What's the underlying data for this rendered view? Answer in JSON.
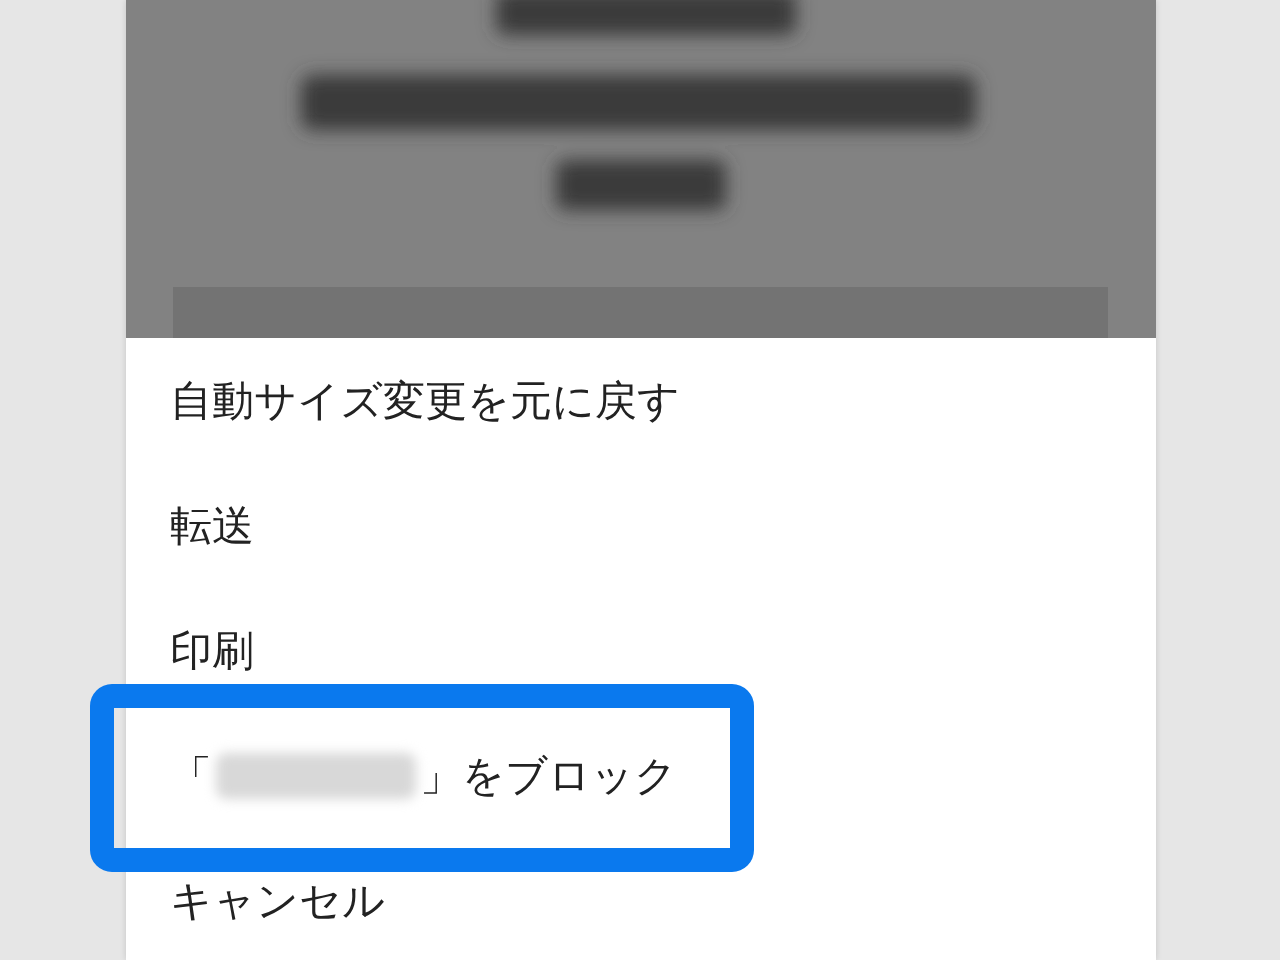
{
  "menu": [
    {
      "kind": "text",
      "label": "自動サイズ変更を元に戻す",
      "selected": false
    },
    {
      "kind": "text",
      "label": "転送",
      "selected": false
    },
    {
      "kind": "text",
      "label": "印刷",
      "selected": false
    },
    {
      "kind": "redacted",
      "prefix": "「",
      "suffix": "」をブロック",
      "selected": true
    },
    {
      "kind": "text",
      "label": "キャンセル",
      "selected": false
    }
  ]
}
